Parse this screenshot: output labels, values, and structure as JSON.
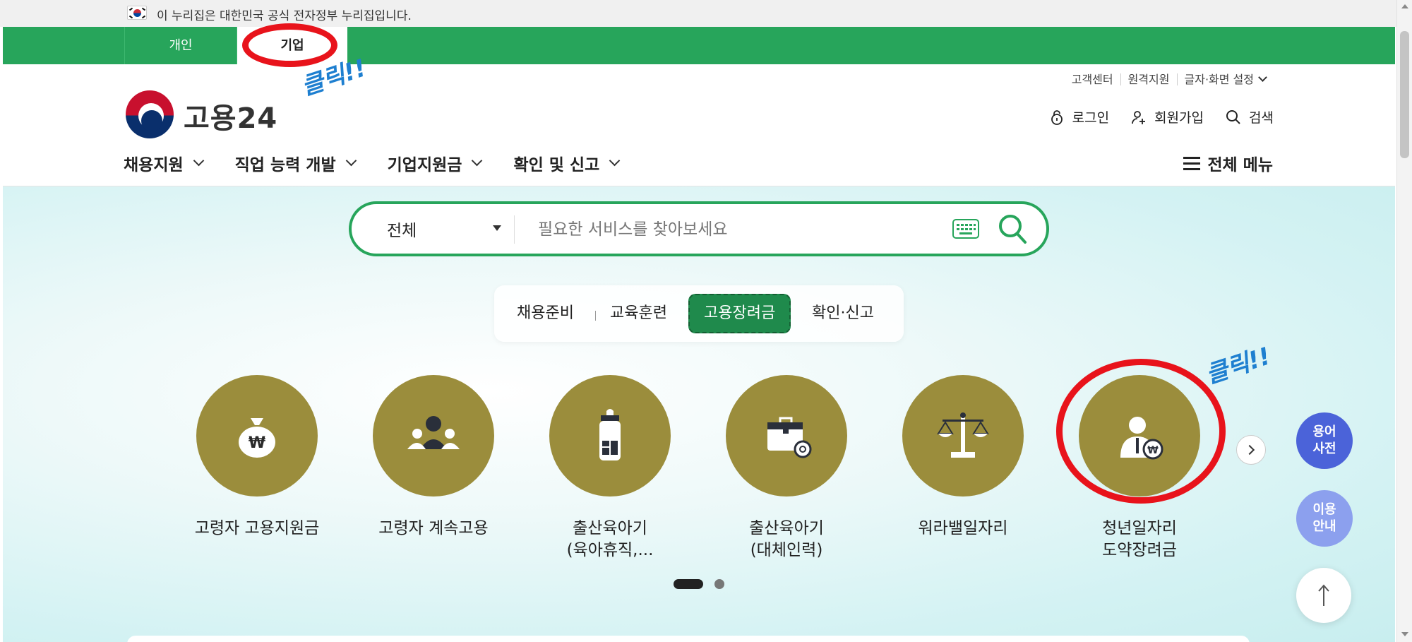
{
  "gov_banner": {
    "text": "이 누리집은 대한민국 공식 전자정부 누리집입니다."
  },
  "top_tabs": [
    {
      "label": "개인"
    },
    {
      "label": "기업"
    }
  ],
  "annotations": [
    {
      "text": "클릭!!"
    },
    {
      "text": "클릭!!"
    }
  ],
  "util_links": [
    {
      "label": "고객센터"
    },
    {
      "label": "원격지원"
    },
    {
      "label": "글자·화면 설정"
    }
  ],
  "logo": {
    "text": "고용24"
  },
  "user_actions": [
    {
      "label": "로그인",
      "icon": "lock-icon"
    },
    {
      "label": "회원가입",
      "icon": "user-add-icon"
    },
    {
      "label": "검색",
      "icon": "search-icon"
    }
  ],
  "gnb": [
    {
      "label": "채용지원"
    },
    {
      "label": "직업 능력 개발"
    },
    {
      "label": "기업지원금"
    },
    {
      "label": "확인 및 신고"
    }
  ],
  "full_menu": {
    "label": "전체 메뉴"
  },
  "search": {
    "scope": "전체",
    "placeholder": "필요한 서비스를 찾아보세요"
  },
  "category_tabs": [
    {
      "label": "채용준비",
      "selected": false
    },
    {
      "label": "교육훈련",
      "selected": false
    },
    {
      "label": "고용장려금",
      "selected": true
    },
    {
      "label": "확인·신고",
      "selected": false
    }
  ],
  "services": [
    {
      "label": "고령자 고용지원금",
      "icon": "money-bag-icon"
    },
    {
      "label": "고령자 계속고용",
      "icon": "group-icon"
    },
    {
      "label": "출산육아기\n(육아휴직,...",
      "icon": "baby-bottle-icon"
    },
    {
      "label": "출산육아기\n(대체인력)",
      "icon": "briefcase-icon"
    },
    {
      "label": "워라밸일자리",
      "icon": "scale-icon"
    },
    {
      "label": "청년일자리\n도약장려금",
      "icon": "person-won-icon"
    }
  ],
  "carousel": {
    "pages": 2,
    "current": 1
  },
  "float_buttons": [
    {
      "label": "용어\n사전"
    },
    {
      "label": "이용\n안내"
    }
  ],
  "colors": {
    "primary_green": "#27a55b",
    "selected_tab": "#1f8a4c",
    "service_circle": "#9b8d3c",
    "annotation_red": "#e8131b",
    "annotation_blue": "#1e7fd0",
    "dict_button": "#4b63d9",
    "guide_button": "#8ca0ee"
  }
}
